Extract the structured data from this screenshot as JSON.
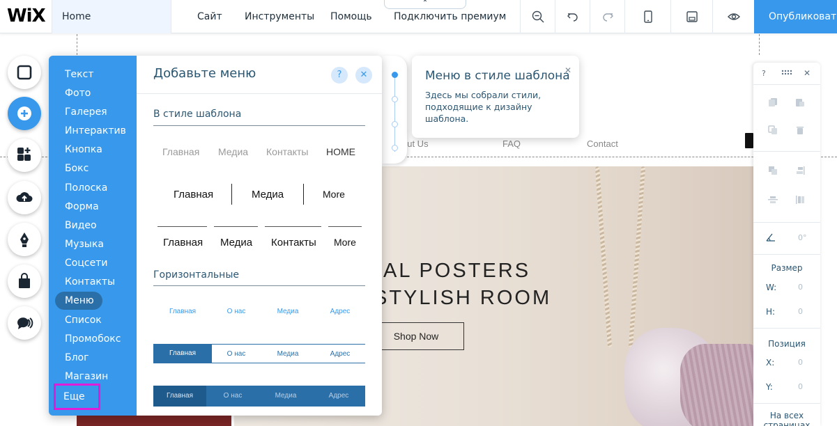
{
  "topbar": {
    "logo": "WiX",
    "page": "Home",
    "menu": [
      "Сайт",
      "Инструменты",
      "Помощь",
      "Подключить премиум"
    ],
    "collapse_glyph": "⌃",
    "tools": [
      "zoom-out-icon",
      "undo-icon",
      "redo-icon",
      "mobile-icon",
      "save-icon",
      "preview-icon"
    ],
    "publish": "Опубликовать"
  },
  "rail": [
    "page-icon",
    "add-icon",
    "apps-icon",
    "upload-icon",
    "pen-icon",
    "store-bag-icon",
    "chat-icon"
  ],
  "add_panel": {
    "categories": [
      "Текст",
      "Фото",
      "Галерея",
      "Интерактив",
      "Кнопка",
      "Бокс",
      "Полоска",
      "Форма",
      "Видео",
      "Музыка",
      "Соцсети",
      "Контакты",
      "Меню",
      "Список",
      "Промобокс",
      "Блог",
      "Магазин",
      "Еще"
    ],
    "selected_category": "Меню",
    "title": "Добавьте меню",
    "help": "?",
    "close": "✕",
    "section1": "В стиле шаблона",
    "menu1": [
      "Главная",
      "Медиа",
      "Контакты",
      "HOME"
    ],
    "menu2": [
      "Главная",
      "Медиа",
      "More"
    ],
    "menu3": [
      "Главная",
      "Медиа",
      "Контакты",
      "More"
    ],
    "section2": "Горизонтальные",
    "hmenu1": [
      "Главная",
      "О нас",
      "Медиа",
      "Адрес"
    ],
    "hmenu2": [
      "Главная",
      "О нас",
      "Медиа",
      "Адрес"
    ],
    "hmenu3": [
      "Главная",
      "О нас",
      "Медиа",
      "Адрес"
    ]
  },
  "tooltip": {
    "title": "Меню в стиле шаблона",
    "body": "Здесь мы собрали стили, подходящие к дизайну шаблона.",
    "close": "✕"
  },
  "site": {
    "nav": [
      "out Us",
      "FAQ",
      "Contact"
    ],
    "hero_line1": "AL POSTERS",
    "hero_line2": "STYLISH ROOM",
    "shop_button": "Shop Now"
  },
  "inspector": {
    "help": "?",
    "close": "✕",
    "angle": "0°",
    "size_label": "Размер",
    "w_label": "W:",
    "h_label": "H:",
    "w_value": "0",
    "h_value": "0",
    "position_label": "Позиция",
    "x_label": "X:",
    "y_label": "Y:",
    "x_value": "0",
    "y_value": "0",
    "all_pages": "На всех страницах"
  },
  "colors": {
    "accent": "#3899ec",
    "selected_category": "#2b6fa8",
    "highlight_box": "#e21bd9",
    "menu_dark": "#2b6fa8"
  }
}
